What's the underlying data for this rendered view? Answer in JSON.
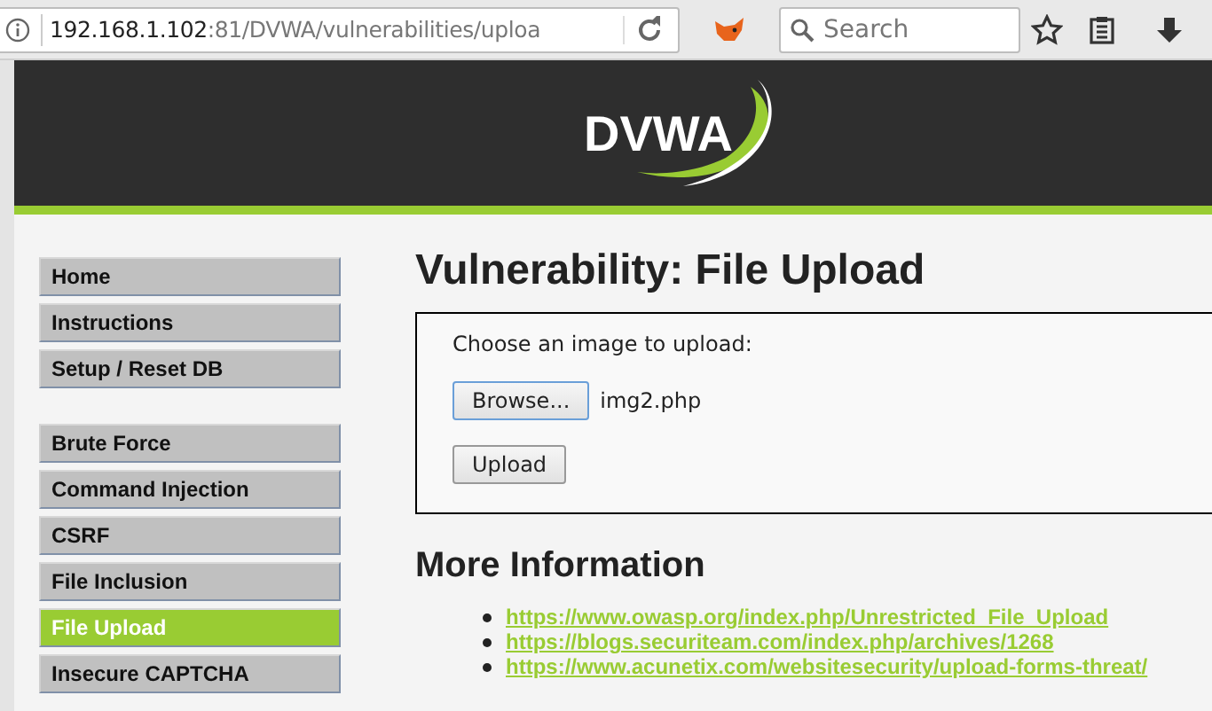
{
  "browser": {
    "url_host": "192.168.1.102",
    "url_path": ":81/DVWA/vulnerabilities/uploa",
    "search": {
      "placeholder": "Search"
    }
  },
  "header": {
    "logo": "DVWA"
  },
  "sidebar": {
    "groups": [
      [
        {
          "label": "Home",
          "selected": false
        },
        {
          "label": "Instructions",
          "selected": false
        },
        {
          "label": "Setup / Reset DB",
          "selected": false
        }
      ],
      [
        {
          "label": "Brute Force",
          "selected": false
        },
        {
          "label": "Command Injection",
          "selected": false
        },
        {
          "label": "CSRF",
          "selected": false
        },
        {
          "label": "File Inclusion",
          "selected": false
        },
        {
          "label": "File Upload",
          "selected": true
        },
        {
          "label": "Insecure CAPTCHA",
          "selected": false
        }
      ]
    ]
  },
  "main": {
    "title": "Vulnerability: File Upload",
    "form": {
      "prompt": "Choose an image to upload:",
      "browse_button": "Browse...",
      "file_name": "img2.php",
      "upload_button": "Upload"
    },
    "more_title": "More Information",
    "links": [
      "https://www.owasp.org/index.php/Unrestricted_File_Upload",
      "https://blogs.securiteam.com/index.php/archives/1268",
      "https://www.acunetix.com/websitesecurity/upload-forms-threat/"
    ]
  }
}
